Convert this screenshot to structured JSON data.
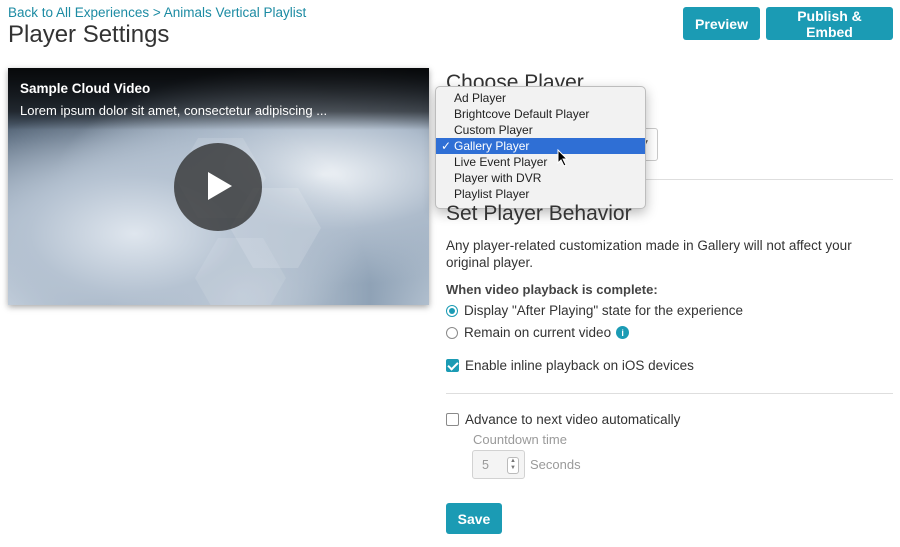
{
  "breadcrumb": {
    "back_link": "Back to All Experiences",
    "separator": ">",
    "current": "Animals Vertical Playlist"
  },
  "page_title": "Player Settings",
  "header_buttons": {
    "preview": "Preview",
    "publish": "Publish & Embed"
  },
  "video": {
    "title": "Sample Cloud Video",
    "description": "Lorem ipsum dolor sit amet, consectetur adipiscing ..."
  },
  "choose_player": {
    "title": "Choose Player",
    "options": [
      "Ad Player",
      "Brightcove Default Player",
      "Custom Player",
      "Gallery Player",
      "Live Event Player",
      "Player with DVR",
      "Playlist Player"
    ],
    "selected": "Gallery Player",
    "check_mark": "✓"
  },
  "player_behavior": {
    "title": "Set Player Behavior",
    "description": "Any player-related customization made in Gallery will not affect your original player.",
    "completion_label": "When video playback is complete:",
    "radio_after_playing": "Display \"After Playing\" state for the experience",
    "radio_remain": "Remain on current video",
    "info_glyph": "i",
    "inline_playback": "Enable inline playback on iOS devices",
    "advance": "Advance to next video automatically",
    "countdown_label": "Countdown time",
    "countdown_value": "5",
    "seconds_label": "Seconds",
    "inline_playback_checked": true,
    "advance_checked": false,
    "after_playing_selected": true
  },
  "save_label": "Save",
  "colors": {
    "accent": "#1b9bb4",
    "selection": "#2f6fd5",
    "link": "#1c8ba3"
  }
}
